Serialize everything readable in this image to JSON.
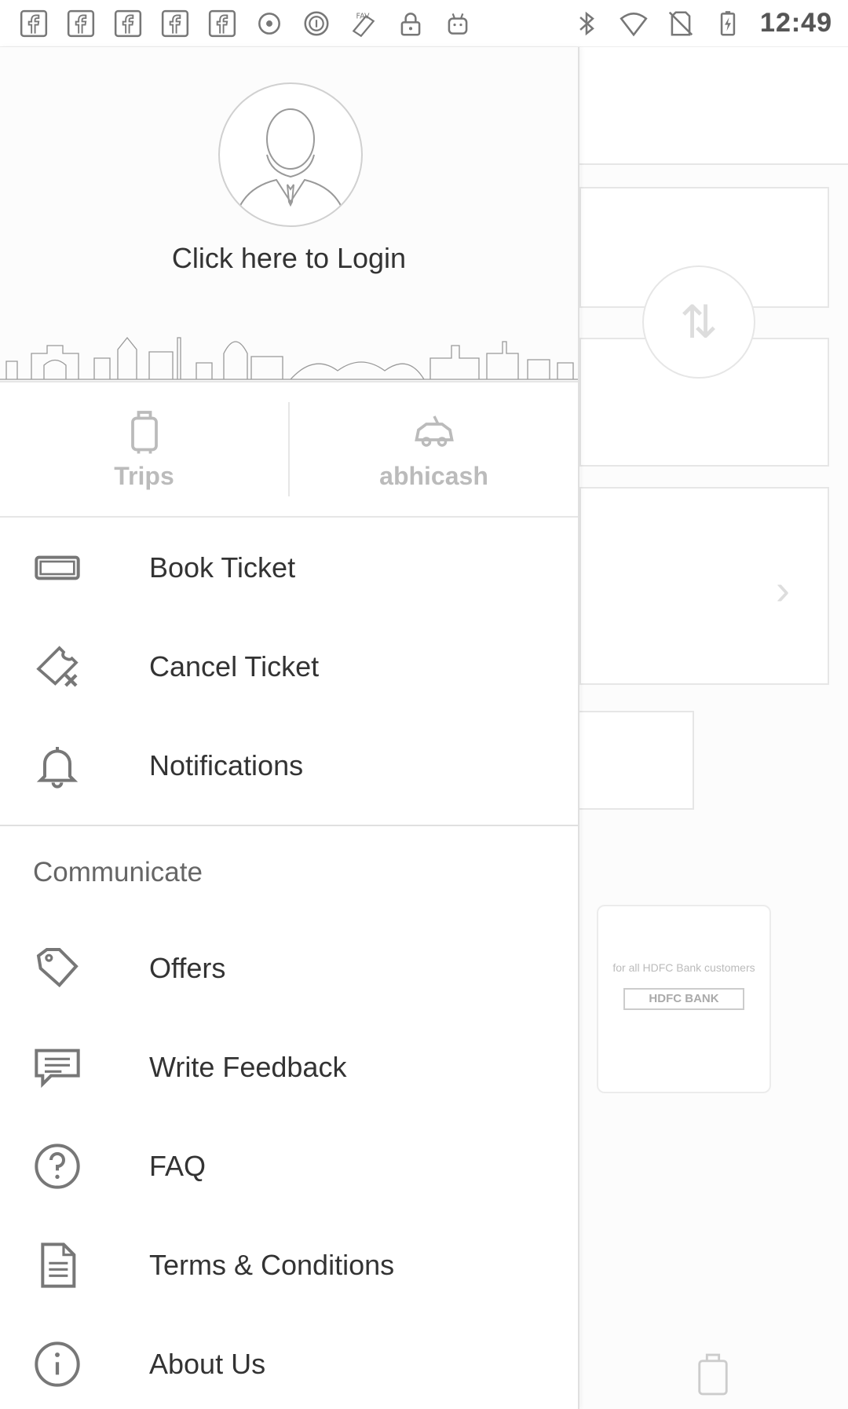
{
  "status_bar": {
    "time": "12:49",
    "left_icons": [
      "facebook-icon",
      "facebook-icon",
      "facebook-icon",
      "facebook-icon",
      "facebook-icon",
      "record-icon",
      "data-saver-icon",
      "app-icon",
      "lock-icon",
      "android-icon"
    ],
    "right_icons": [
      "bluetooth-icon",
      "wifi-icon",
      "no-sim-icon",
      "battery-charging-icon"
    ]
  },
  "drawer": {
    "header": {
      "login_text": "Click here to Login"
    },
    "quick_actions": [
      {
        "label": "Trips",
        "icon": "luggage-icon"
      },
      {
        "label": "abhicash",
        "icon": "wallet-car-icon"
      }
    ],
    "menu": [
      {
        "label": "Book Ticket",
        "icon": "ticket-icon"
      },
      {
        "label": "Cancel Ticket",
        "icon": "cancel-ticket-icon"
      },
      {
        "label": "Notifications",
        "icon": "bell-icon"
      }
    ],
    "communicate": {
      "title": "Communicate",
      "items": [
        {
          "label": "Offers",
          "icon": "tag-icon"
        },
        {
          "label": "Write Feedback",
          "icon": "feedback-icon"
        },
        {
          "label": "FAQ",
          "icon": "question-icon"
        },
        {
          "label": "Terms & Conditions",
          "icon": "document-icon"
        },
        {
          "label": "About Us",
          "icon": "info-icon"
        }
      ]
    }
  },
  "background": {
    "promo_text": "for all HDFC Bank customers",
    "promo_bank": "HDFC BANK",
    "bottom_tab": "trips"
  }
}
